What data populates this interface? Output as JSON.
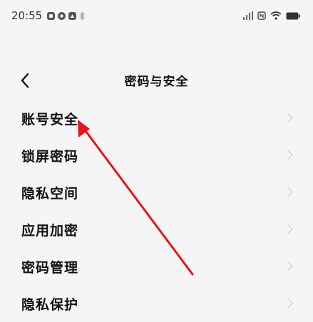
{
  "status_bar": {
    "time": "20:55",
    "left_icons": [
      "app-notification-icon",
      "app-notification-icon",
      "app-notification-icon",
      "bluetooth-icon"
    ],
    "right_icons": [
      "signal-bars-icon",
      "nfc-icon",
      "wifi-icon",
      "battery-icon"
    ]
  },
  "nav": {
    "back_icon": "back-chevron-icon",
    "title": "密码与安全"
  },
  "menu": {
    "items": [
      {
        "label": "账号安全"
      },
      {
        "label": "锁屏密码"
      },
      {
        "label": "隐私空间"
      },
      {
        "label": "应用加密"
      },
      {
        "label": "密码管理"
      },
      {
        "label": "隐私保护"
      }
    ]
  },
  "annotation": {
    "color": "#e8141b"
  }
}
